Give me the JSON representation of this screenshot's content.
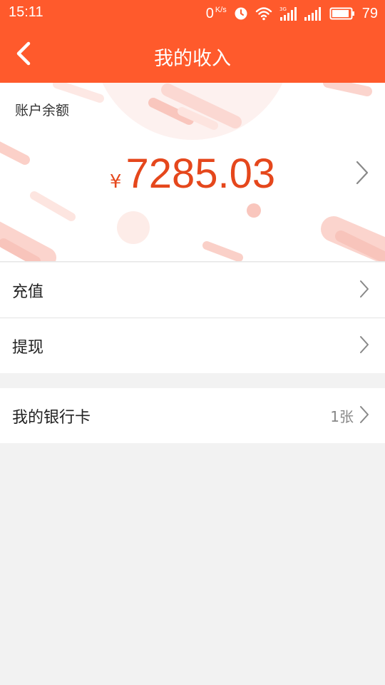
{
  "status_bar": {
    "time": "15:11",
    "net_speed": "0",
    "net_speed_unit": "K/s",
    "battery_level": "79",
    "icons": [
      "alarm-icon",
      "wifi-icon",
      "3g-signal-icon",
      "signal-icon",
      "battery-icon"
    ]
  },
  "header": {
    "title": "我的收入",
    "back_icon": "back-chevron-icon"
  },
  "balance": {
    "label": "账户余额",
    "currency_symbol": "¥",
    "amount": "7285.03"
  },
  "menu": {
    "recharge_label": "充值",
    "withdraw_label": "提现",
    "bank_card_label": "我的银行卡",
    "bank_card_count": "1张"
  },
  "colors": {
    "accent": "#ff5a2c",
    "amount": "#e5471c",
    "background": "#f2f2f2"
  }
}
